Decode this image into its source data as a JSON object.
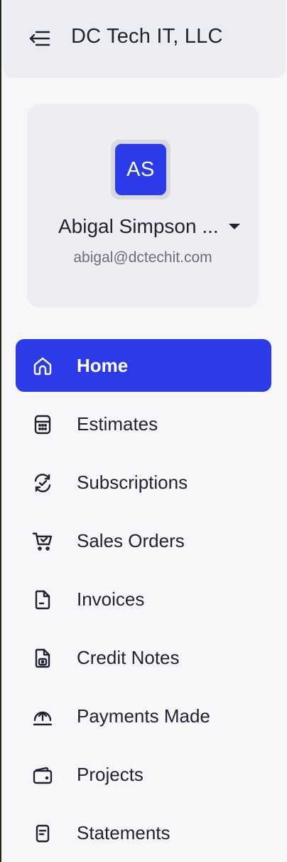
{
  "header": {
    "org_name": "DC Tech IT, LLC",
    "menu_icon": "menu-collapse-icon"
  },
  "profile": {
    "initials": "AS",
    "name": "Abigal Simpson ...",
    "email": "abigal@dctechit.com",
    "avatar_color": "#2b3be8"
  },
  "nav": {
    "items": [
      {
        "label": "Home",
        "icon": "home-icon",
        "active": true
      },
      {
        "label": "Estimates",
        "icon": "calculator-icon",
        "active": false
      },
      {
        "label": "Subscriptions",
        "icon": "refresh-check-icon",
        "active": false
      },
      {
        "label": "Sales Orders",
        "icon": "cart-icon",
        "active": false
      },
      {
        "label": "Invoices",
        "icon": "invoice-icon",
        "active": false
      },
      {
        "label": "Credit Notes",
        "icon": "credit-note-icon",
        "active": false
      },
      {
        "label": "Payments Made",
        "icon": "payment-upload-icon",
        "active": false
      },
      {
        "label": "Projects",
        "icon": "briefcase-icon",
        "active": false
      },
      {
        "label": "Statements",
        "icon": "statement-icon",
        "active": false
      }
    ]
  },
  "colors": {
    "accent": "#2b3be8",
    "text": "#1f2230",
    "muted": "#6b6e7a"
  }
}
